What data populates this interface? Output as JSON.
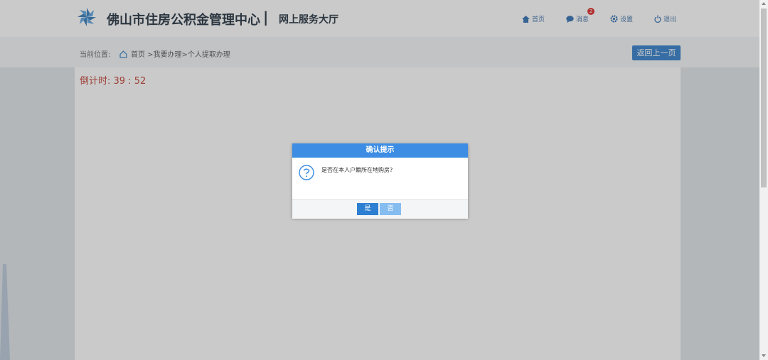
{
  "header": {
    "brand_name": "佛山市住房公积金管理中心",
    "separator": "|",
    "subtitle": "网上服务大厅",
    "nav": [
      {
        "label": "首页",
        "icon": "home-icon"
      },
      {
        "label": "消息",
        "icon": "message-icon",
        "badge": "2"
      },
      {
        "label": "设置",
        "icon": "gear-icon"
      },
      {
        "label": "退出",
        "icon": "power-icon"
      }
    ]
  },
  "breadcrumb": {
    "label": "当前位置:",
    "path": "首页 >我要办理>个人提取办理",
    "back_label": "返回上一页"
  },
  "countdown": "倒计时: 39 : 52",
  "dialog": {
    "title": "确认提示",
    "message": "是否在本人户籍所在地购房?",
    "yes_label": "是",
    "no_label": "否"
  },
  "colors": {
    "accent": "#2b7ac9",
    "dialog_header": "#3c8de3",
    "countdown": "#c0392b",
    "badge": "#dd2222"
  }
}
